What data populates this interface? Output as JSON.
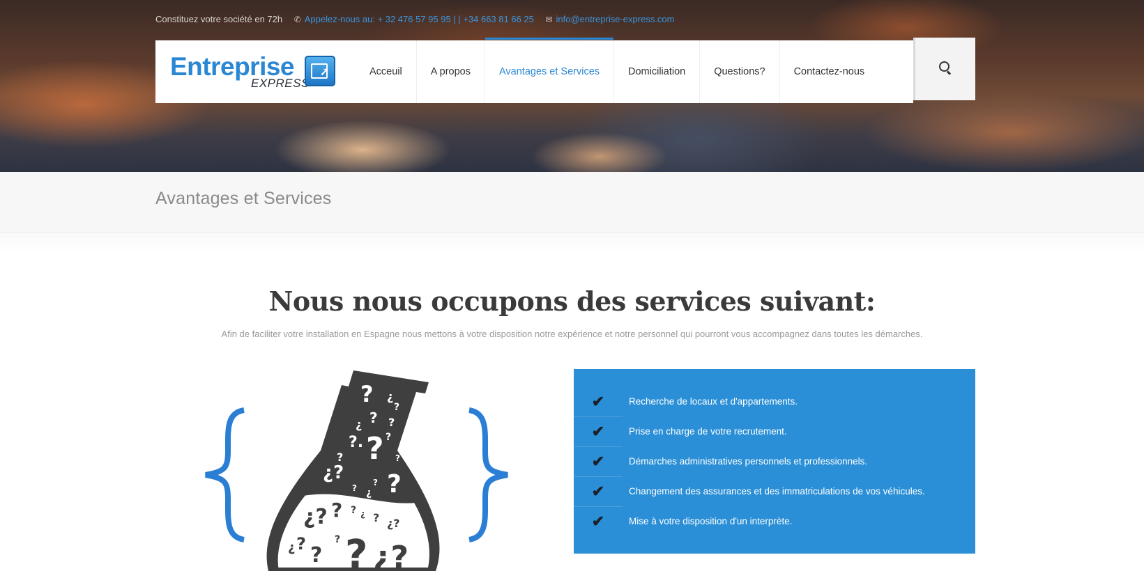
{
  "topbar": {
    "tagline": "Constituez votre société en 72h",
    "phone_icon": "phone-icon",
    "phone": "Appelez-nous au: + 32 476 57 95 95 | | +34 663 81 66 25",
    "mail_icon": "envelope-icon",
    "email": "info@entreprise-express.com"
  },
  "logo": {
    "word": "Entreprise",
    "sub": "EXPRESS"
  },
  "nav": {
    "items": [
      {
        "label": "Acceuil"
      },
      {
        "label": "A propos"
      },
      {
        "label": "Avantages et Services"
      },
      {
        "label": "Domiciliation"
      },
      {
        "label": "Questions?"
      },
      {
        "label": "Contactez-nous"
      }
    ],
    "active_index": 2,
    "search_icon": "search-icon"
  },
  "page": {
    "title": "Avantages et Services"
  },
  "main": {
    "heading": "Nous nous occupons des services suivant:",
    "subline": "Afin de faciliter votre installation en Espagne nous mettons à votre disposition notre expérience et notre personnel qui pourront vous accompagnez dans toutes les démarches.",
    "services": [
      {
        "label": "Recherche de locaux et d'appartements."
      },
      {
        "label": "Prise en charge de votre recrutement."
      },
      {
        "label": "Démarches administratives personnels et professionnels."
      },
      {
        "label": "Changement des assurances et des immatriculations de vos véhicules."
      },
      {
        "label": "Mise à votre disposition d'un interprète."
      }
    ]
  },
  "colors": {
    "accent": "#2b87d3",
    "service_box": "#2a8fd6",
    "heading": "#3a3a3a"
  }
}
